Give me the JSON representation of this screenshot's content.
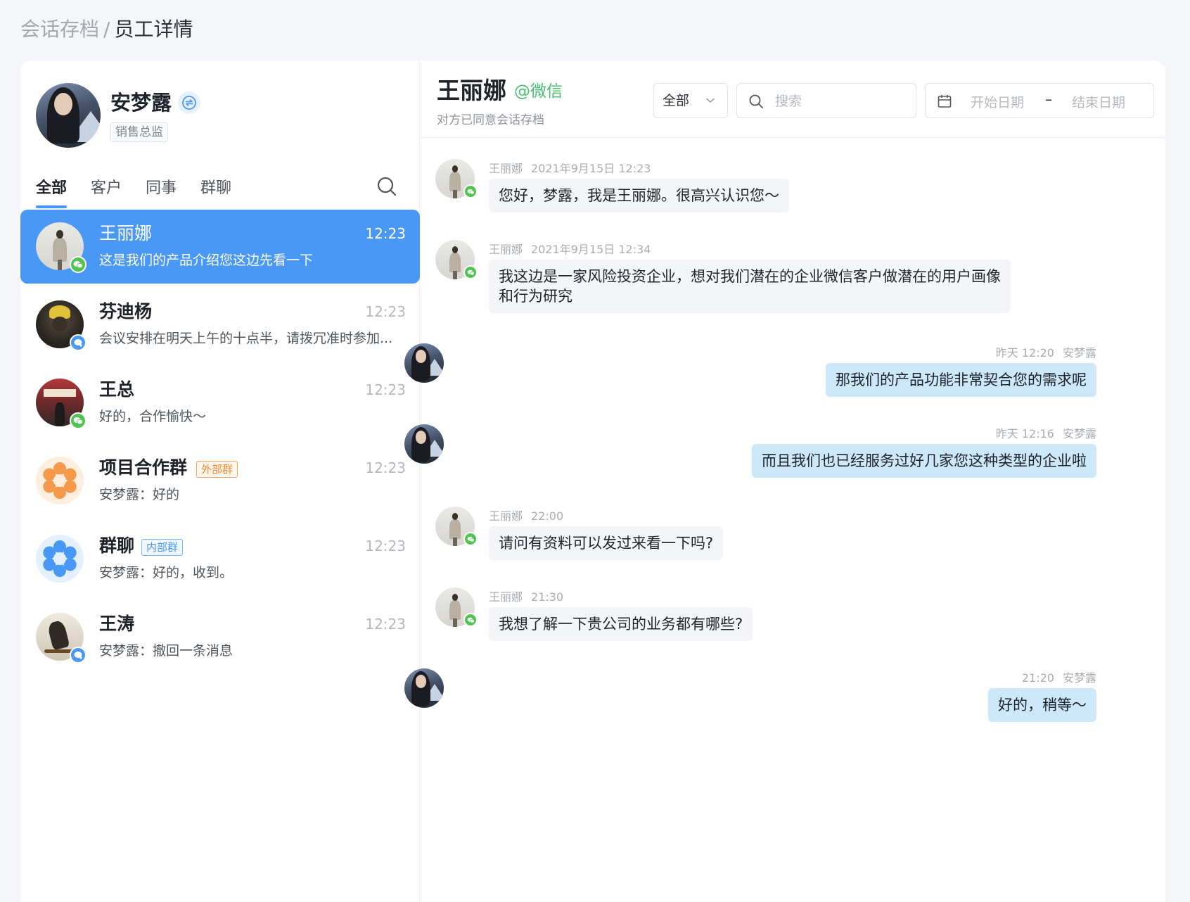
{
  "breadcrumb": {
    "root": "会话存档",
    "separator": "/",
    "current": "员工详情"
  },
  "profile": {
    "name": "安梦露",
    "role": "销售总监"
  },
  "tabs": [
    {
      "label": "全部",
      "active": true
    },
    {
      "label": "客户",
      "active": false
    },
    {
      "label": "同事",
      "active": false
    },
    {
      "label": "群聊",
      "active": false
    }
  ],
  "conversations": [
    {
      "name": "王丽娜",
      "time": "12:23",
      "preview": "这是我们的产品介绍您这边先看一下",
      "tag": "",
      "badge": "wechat"
    },
    {
      "name": "芬迪杨",
      "time": "12:23",
      "preview": "会议安排在明天上午的十点半，请拨冗准时参加...",
      "tag": "",
      "badge": "work"
    },
    {
      "name": "王总",
      "time": "12:23",
      "preview": "好的，合作愉快～",
      "tag": "",
      "badge": "wechat"
    },
    {
      "name": "项目合作群",
      "time": "12:23",
      "preview": "安梦露：好的",
      "tag": "外部群",
      "badge": ""
    },
    {
      "name": "群聊",
      "time": "12:23",
      "preview": "安梦露：好的，收到。",
      "tag": "内部群",
      "badge": ""
    },
    {
      "name": "王涛",
      "time": "12:23",
      "preview": "安梦露：撤回一条消息",
      "tag": "",
      "badge": "work"
    }
  ],
  "chat": {
    "contact_name": "王丽娜",
    "contact_platform": "@微信",
    "consent_status": "对方已同意会话存档",
    "filter": {
      "selected": "全部"
    },
    "search": {
      "placeholder": "搜索"
    },
    "date_range": {
      "start_placeholder": "开始日期",
      "separator": "–",
      "end_placeholder": "结束日期"
    },
    "messages": [
      {
        "direction": "in",
        "sender": "王丽娜",
        "time": "2021年9月15日 12:23",
        "lines": [
          "您好，梦露，我是王丽娜。很高兴认识您～"
        ]
      },
      {
        "direction": "in",
        "sender": "王丽娜",
        "time": "2021年9月15日 12:34",
        "lines": [
          "我这边是一家风险投资企业，想对我们潜在的企业微信客户做潜在的用户画像",
          "和行为研究"
        ]
      },
      {
        "direction": "out",
        "sender": "安梦露",
        "time": "昨天 12:20",
        "lines": [
          "那我们的产品功能非常契合您的需求呢"
        ]
      },
      {
        "direction": "out",
        "sender": "安梦露",
        "time": "昨天 12:16",
        "lines": [
          "而且我们也已经服务过好几家您这种类型的企业啦"
        ]
      },
      {
        "direction": "in",
        "sender": "王丽娜",
        "time": "22:00",
        "lines": [
          "请问有资料可以发过来看一下吗?"
        ]
      },
      {
        "direction": "in",
        "sender": "王丽娜",
        "time": "21:30",
        "lines": [
          "我想了解一下贵公司的业务都有哪些?"
        ]
      },
      {
        "direction": "out",
        "sender": "安梦露",
        "time": "21:20",
        "lines": [
          "好的，稍等～"
        ]
      }
    ]
  },
  "colors": {
    "accent": "#4a98f5",
    "wechat_green": "#4fc44f",
    "outgoing_bubble": "#cde8fb",
    "external_tag": "#f08a2c"
  },
  "icons": {
    "search": "search-icon",
    "switch": "switch-icon",
    "calendar": "calendar-icon",
    "chevron": "chevron-down-icon",
    "wechat": "wechat-icon",
    "work_wechat": "work-wechat-icon"
  }
}
